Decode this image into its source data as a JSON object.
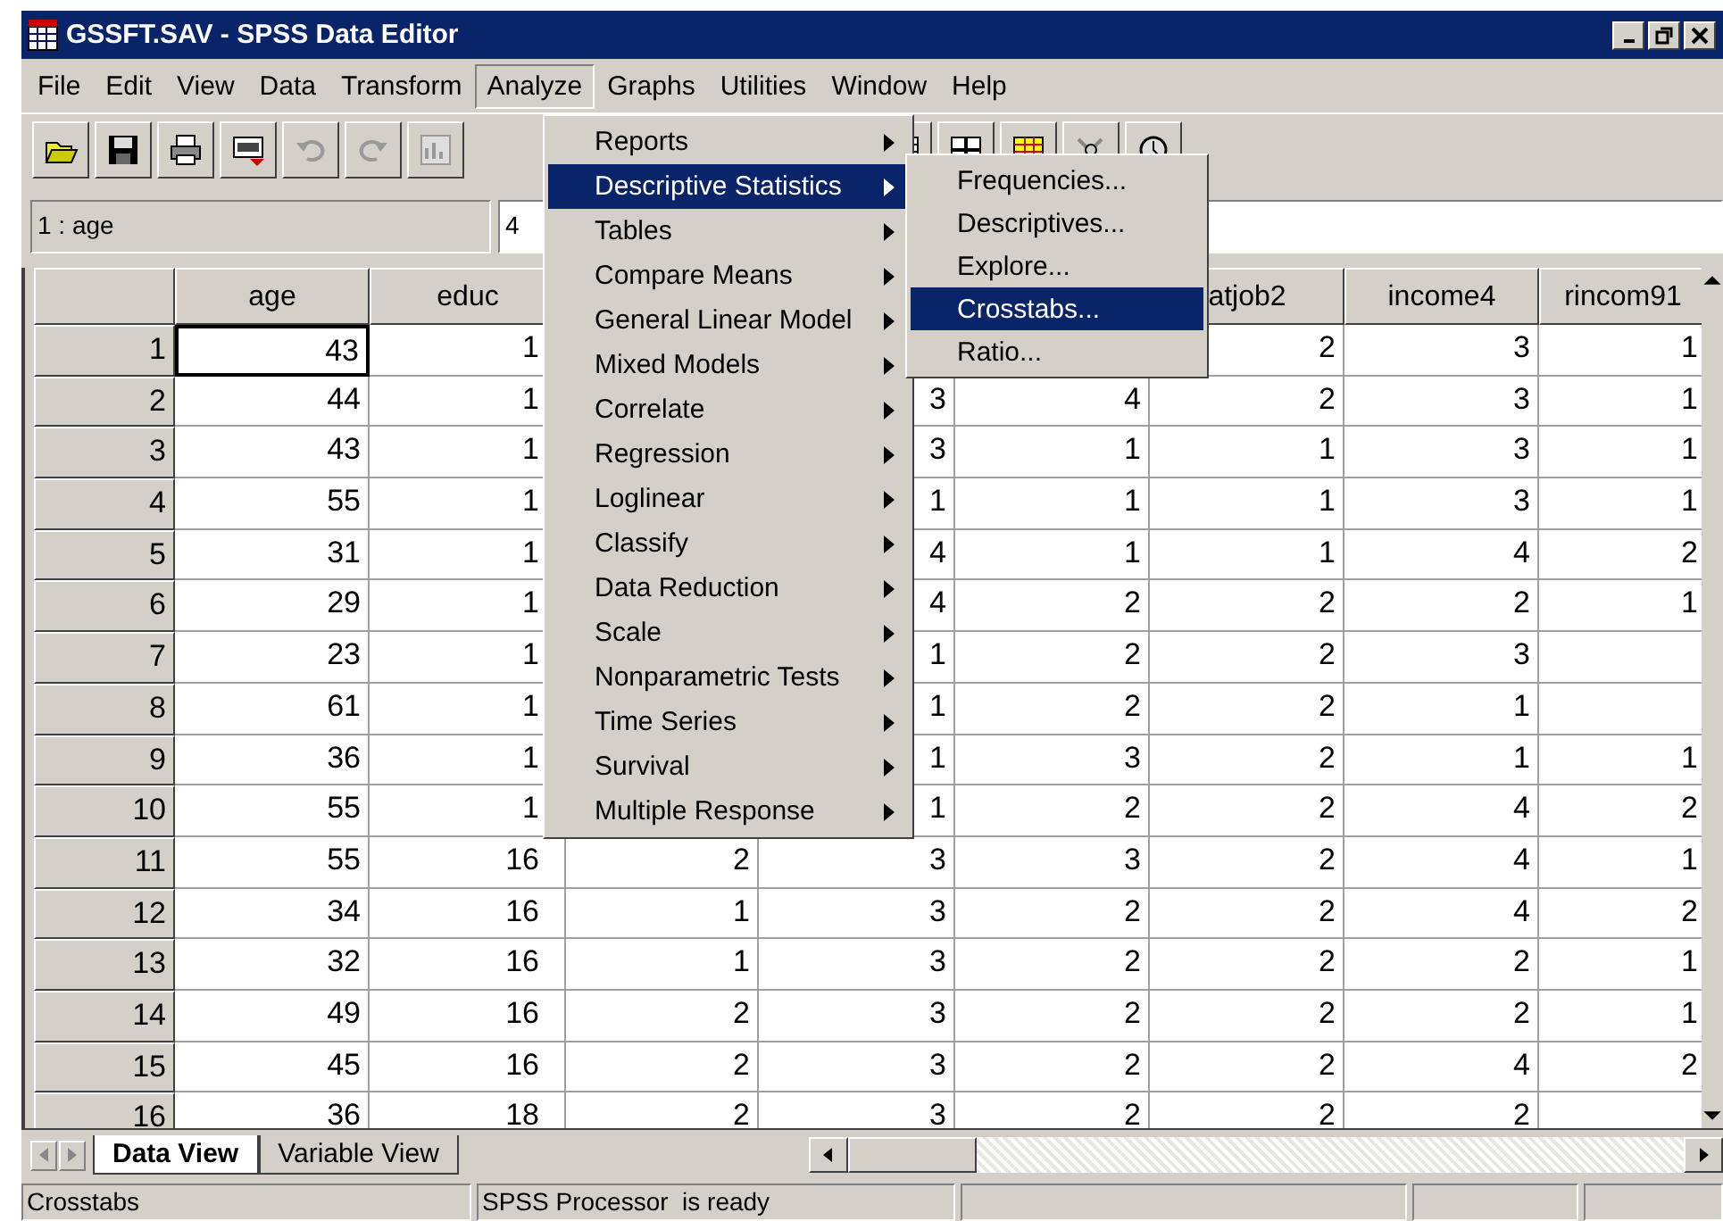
{
  "window": {
    "title": "GSSFT.SAV - SPSS Data Editor"
  },
  "menu_bar": [
    {
      "label": "File",
      "selected": false
    },
    {
      "label": "Edit",
      "selected": false
    },
    {
      "label": "View",
      "selected": false
    },
    {
      "label": "Data",
      "selected": false
    },
    {
      "label": "Transform",
      "selected": false
    },
    {
      "label": "Analyze",
      "selected": true
    },
    {
      "label": "Graphs",
      "selected": false
    },
    {
      "label": "Utilities",
      "selected": false
    },
    {
      "label": "Window",
      "selected": false
    },
    {
      "label": "Help",
      "selected": false
    }
  ],
  "cell_editor": {
    "cell_ref": "1 : age",
    "value": "4"
  },
  "analyze_menu": [
    {
      "label": "Reports",
      "selected": false
    },
    {
      "label": "Descriptive Statistics",
      "selected": true
    },
    {
      "label": "Tables",
      "selected": false
    },
    {
      "label": "Compare Means",
      "selected": false
    },
    {
      "label": "General Linear Model",
      "selected": false
    },
    {
      "label": "Mixed Models",
      "selected": false
    },
    {
      "label": "Correlate",
      "selected": false
    },
    {
      "label": "Regression",
      "selected": false
    },
    {
      "label": "Loglinear",
      "selected": false
    },
    {
      "label": "Classify",
      "selected": false
    },
    {
      "label": "Data Reduction",
      "selected": false
    },
    {
      "label": "Scale",
      "selected": false
    },
    {
      "label": "Nonparametric Tests",
      "selected": false
    },
    {
      "label": "Time Series",
      "selected": false
    },
    {
      "label": "Survival",
      "selected": false
    },
    {
      "label": "Multiple Response",
      "selected": false
    }
  ],
  "submenu": [
    {
      "label": "Frequencies...",
      "selected": false
    },
    {
      "label": "Descriptives...",
      "selected": false
    },
    {
      "label": "Explore...",
      "selected": false
    },
    {
      "label": "Crosstabs...",
      "selected": true
    },
    {
      "label": "Ratio...",
      "selected": false
    }
  ],
  "table": {
    "columns": [
      "age",
      "educ",
      null,
      null,
      null,
      "atjob2",
      "income4",
      "rincom91"
    ],
    "rows": [
      {
        "number": "1",
        "selected": true,
        "cells": [
          "43",
          "1",
          null,
          null,
          null,
          "2",
          "3",
          "1"
        ]
      },
      {
        "number": "2",
        "selected": false,
        "cells": [
          "44",
          "1",
          null,
          "3",
          "4",
          "2",
          "3",
          "1"
        ]
      },
      {
        "number": "3",
        "selected": false,
        "cells": [
          "43",
          "1",
          null,
          "3",
          "1",
          "1",
          "3",
          "1"
        ]
      },
      {
        "number": "4",
        "selected": false,
        "cells": [
          "55",
          "1",
          null,
          "1",
          "1",
          "1",
          "3",
          "1"
        ]
      },
      {
        "number": "5",
        "selected": false,
        "cells": [
          "31",
          "1",
          null,
          "4",
          "1",
          "1",
          "4",
          "2"
        ]
      },
      {
        "number": "6",
        "selected": false,
        "cells": [
          "29",
          "1",
          null,
          "4",
          "2",
          "2",
          "2",
          "1"
        ]
      },
      {
        "number": "7",
        "selected": false,
        "cells": [
          "23",
          "1",
          null,
          "1",
          "2",
          "2",
          "3",
          null
        ]
      },
      {
        "number": "8",
        "selected": false,
        "cells": [
          "61",
          "1",
          null,
          "1",
          "2",
          "2",
          "1",
          null
        ]
      },
      {
        "number": "9",
        "selected": false,
        "cells": [
          "36",
          "1",
          null,
          "1",
          "3",
          "2",
          "1",
          "1"
        ]
      },
      {
        "number": "10",
        "selected": false,
        "cells": [
          "55",
          "1",
          null,
          "1",
          "2",
          "2",
          "4",
          "2"
        ]
      },
      {
        "number": "11",
        "selected": false,
        "cells": [
          "55",
          "16",
          "2",
          "3",
          "3",
          "2",
          "4",
          "1"
        ]
      },
      {
        "number": "12",
        "selected": false,
        "cells": [
          "34",
          "16",
          "1",
          "3",
          "2",
          "2",
          "4",
          "2"
        ]
      },
      {
        "number": "13",
        "selected": false,
        "cells": [
          "32",
          "16",
          "1",
          "3",
          "2",
          "2",
          "2",
          "1"
        ]
      },
      {
        "number": "14",
        "selected": false,
        "cells": [
          "49",
          "16",
          "2",
          "3",
          "2",
          "2",
          "2",
          "1"
        ]
      },
      {
        "number": "15",
        "selected": false,
        "cells": [
          "45",
          "16",
          "2",
          "3",
          "2",
          "2",
          "4",
          "2"
        ]
      },
      {
        "number": "16",
        "selected": false,
        "cells": [
          "36",
          "18",
          "2",
          "3",
          "2",
          "2",
          "2",
          null
        ]
      }
    ]
  },
  "view_tabs": [
    {
      "label": "Data View",
      "selected": true
    },
    {
      "label": "Variable View",
      "selected": false
    }
  ],
  "status_bar": [
    "Crosstabs",
    "SPSS Processor  is ready"
  ]
}
